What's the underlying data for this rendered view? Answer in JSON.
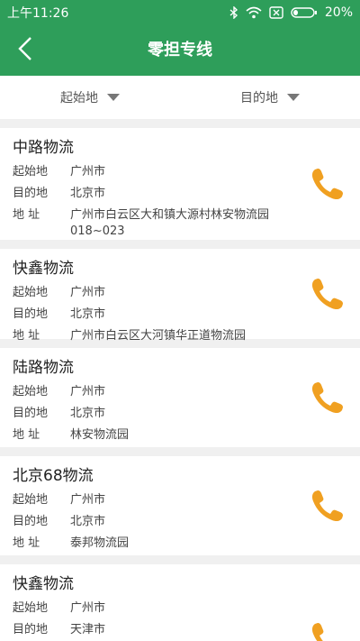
{
  "status": {
    "time": "上午11:26",
    "battery": "20%"
  },
  "header": {
    "title": "零担专线"
  },
  "filters": {
    "origin_label": "起始地",
    "destination_label": "目的地"
  },
  "labels": {
    "origin": "起始地",
    "destination": "目的地",
    "address": "地 址"
  },
  "companies": [
    {
      "name": "中路物流",
      "origin": "广州市",
      "destination": "北京市",
      "address": "广州市白云区大和镇大源村林安物流园018~023"
    },
    {
      "name": "快鑫物流",
      "origin": "广州市",
      "destination": "北京市",
      "address": "广州市白云区大河镇华正道物流园"
    },
    {
      "name": "陆路物流",
      "origin": "广州市",
      "destination": "北京市",
      "address": "林安物流园"
    },
    {
      "name": "北京68物流",
      "origin": "广州市",
      "destination": "北京市",
      "address": "泰邦物流园"
    },
    {
      "name": "快鑫物流",
      "origin": "广州市",
      "destination": "天津市"
    }
  ],
  "colors": {
    "brand": "#2e9e5a",
    "call": "#f0a021"
  }
}
